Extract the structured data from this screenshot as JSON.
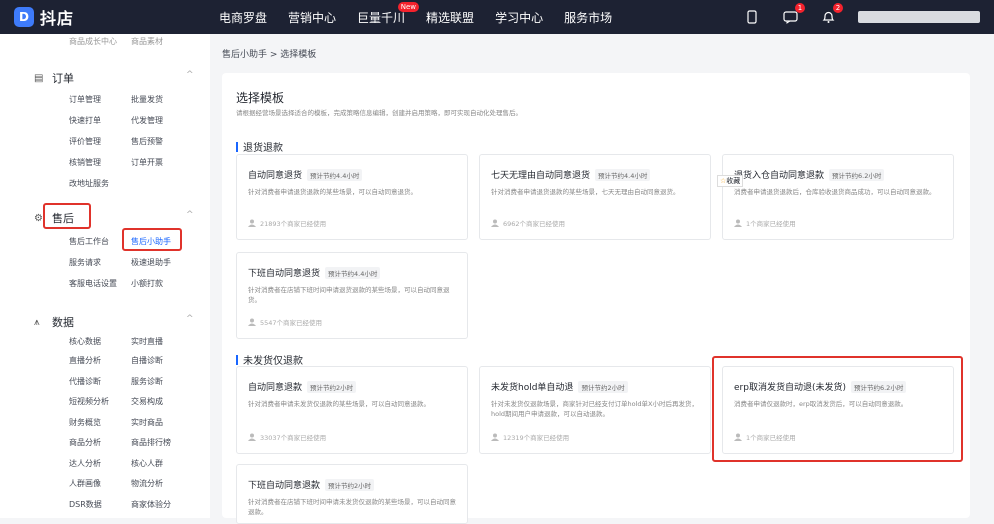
{
  "header": {
    "logo": "抖店",
    "nav": [
      "电商罗盘",
      "营销中心",
      "巨量千川",
      "精选联盟",
      "学习中心",
      "服务市场"
    ],
    "new_badge": "New",
    "msg_count": "1",
    "bell_count": "2"
  },
  "sidebar": {
    "top_items": [
      "商品成长中心",
      "商品素材"
    ],
    "orders": {
      "title": "订单",
      "items": [
        "订单管理",
        "批量发货",
        "快速打单",
        "代发管理",
        "评价管理",
        "售后预警",
        "核销管理",
        "订单开票",
        "改地址服务"
      ]
    },
    "after_sales": {
      "title": "售后",
      "items": [
        "售后工作台",
        "售后小助手",
        "服务请求",
        "极速退助手",
        "客服电话设置",
        "小额打款"
      ]
    },
    "data": {
      "title": "数据",
      "items": [
        "核心数据",
        "实时直播",
        "直播分析",
        "自播诊断",
        "代播诊断",
        "服务诊断",
        "短视频分析",
        "交易构成",
        "财务概览",
        "实时商品",
        "商品分析",
        "商品排行榜",
        "达人分析",
        "核心人群",
        "人群画像",
        "物流分析",
        "DSR数据",
        "商家体验分"
      ]
    }
  },
  "breadcrumb": "售后小助手 > 选择模板",
  "panel": {
    "title": "选择模板",
    "desc": "请根据经营场景选择适合的模板，完成策略信息编辑，创建并启用策略，即可实现自动化处理售后。"
  },
  "sections": [
    {
      "title": "退货退款",
      "cards": [
        {
          "title": "自动同意退货",
          "save": "预计节约4.4小时",
          "desc": "针对消费者申请退货退款的某些场景，可以自动同意退货。",
          "users": "21893个商家已经使用"
        },
        {
          "title": "七天无理由自动同意退货",
          "save": "预计节约4.4小时",
          "desc": "针对消费者申请退货退款的某些场景，七天无理由自动同意退货。",
          "users": "6962个商家已经使用"
        },
        {
          "title": "退货入仓自动同意退款",
          "save": "预计节约6.2小时",
          "desc": "消费者申请退货退款后，仓库验收退货商品成功，可以自动同意退款。",
          "users": "1个商家已经使用"
        },
        {
          "title": "下班自动同意退货",
          "save": "预计节约4.4小时",
          "desc": "针对消费者在店铺下班时间申请退货退款的某些场景，可以自动同意退货。",
          "users": "5547个商家已经使用"
        }
      ]
    },
    {
      "title": "未发货仅退款",
      "cards": [
        {
          "title": "自动同意退款",
          "save": "预计节约2小时",
          "desc": "针对消费者申请未发货仅退款的某些场景，可以自动同意退款。",
          "users": "33037个商家已经使用"
        },
        {
          "title": "未发货hold单自动退",
          "save": "预计节约2小时",
          "desc": "针对未发货仅退款场景，商家针对已经支付订单hold单X小时后再发货，hold期间用户申请退款，可以自动退款。",
          "users": "12319个商家已经使用"
        },
        {
          "title": "erp取消发货自动退(未发货)",
          "save": "预计节约6.2小时",
          "desc": "消费者申请仅退款时，erp取消发货后，可以自动同意退款。",
          "users": "1个商家已经使用"
        },
        {
          "title": "下班自动同意退款",
          "save": "预计节约2小时",
          "desc": "针对消费者在店铺下班时间申请未发货仅退款的某些场景，可以自动同意退款。",
          "users": ""
        }
      ]
    }
  ],
  "fav_label": "收藏",
  "colors": {
    "topbar": "#1d2233",
    "accent": "#1966ff",
    "highlight": "#e0332b"
  }
}
